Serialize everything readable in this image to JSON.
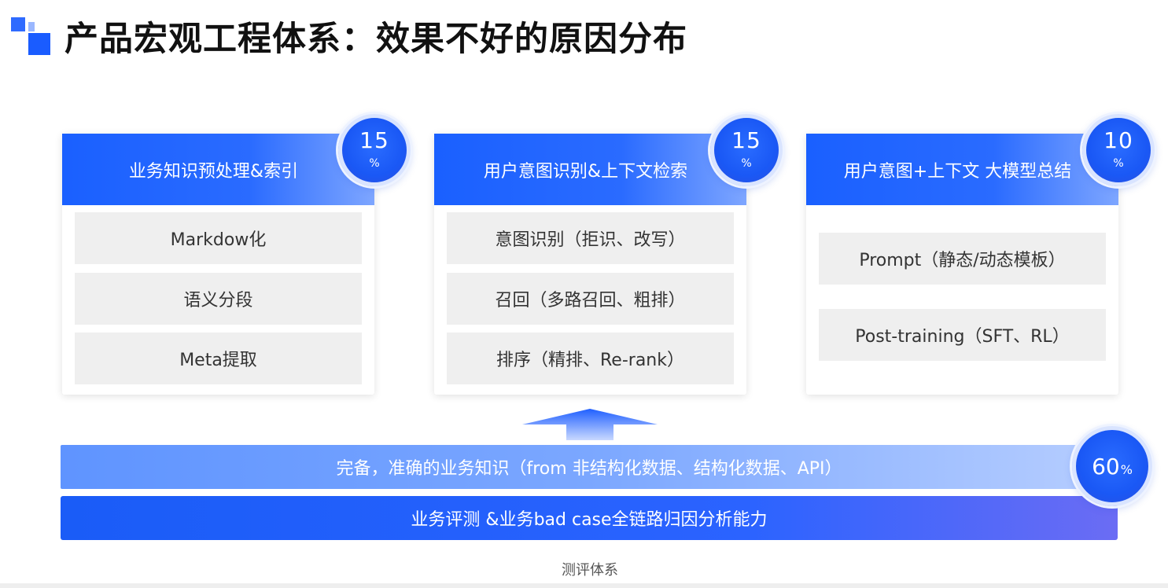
{
  "title": "产品宏观工程体系：效果不好的原因分布",
  "cards": [
    {
      "header": "业务知识预处理&索引",
      "badge": {
        "value": "15",
        "unit": "%"
      },
      "items": [
        "Markdow化",
        "语义分段",
        "Meta提取"
      ]
    },
    {
      "header": "用户意图识别&上下文检索",
      "badge": {
        "value": "15",
        "unit": "%"
      },
      "items": [
        "意图识别（拒识、改写）",
        "召回（多路召回、粗排）",
        "排序（精排、Re-rank）"
      ]
    },
    {
      "header": "用户意图+上下文 大模型总结",
      "badge": {
        "value": "10",
        "unit": "%"
      },
      "items": [
        "Prompt（静态/动态模板）",
        "Post-training（SFT、RL）"
      ]
    }
  ],
  "band_knowledge": "完备，准确的业务知识（from 非结构化数据、结构化数据、API）",
  "band_eval": "业务评测 &业务bad case全链路归因分析能力",
  "knowledge_badge": {
    "value": "60",
    "unit": "%"
  },
  "caption": "测评体系",
  "colors": {
    "primary": "#1a5cff",
    "item_bg": "#efefef",
    "band_light": "#7ba7ff"
  }
}
